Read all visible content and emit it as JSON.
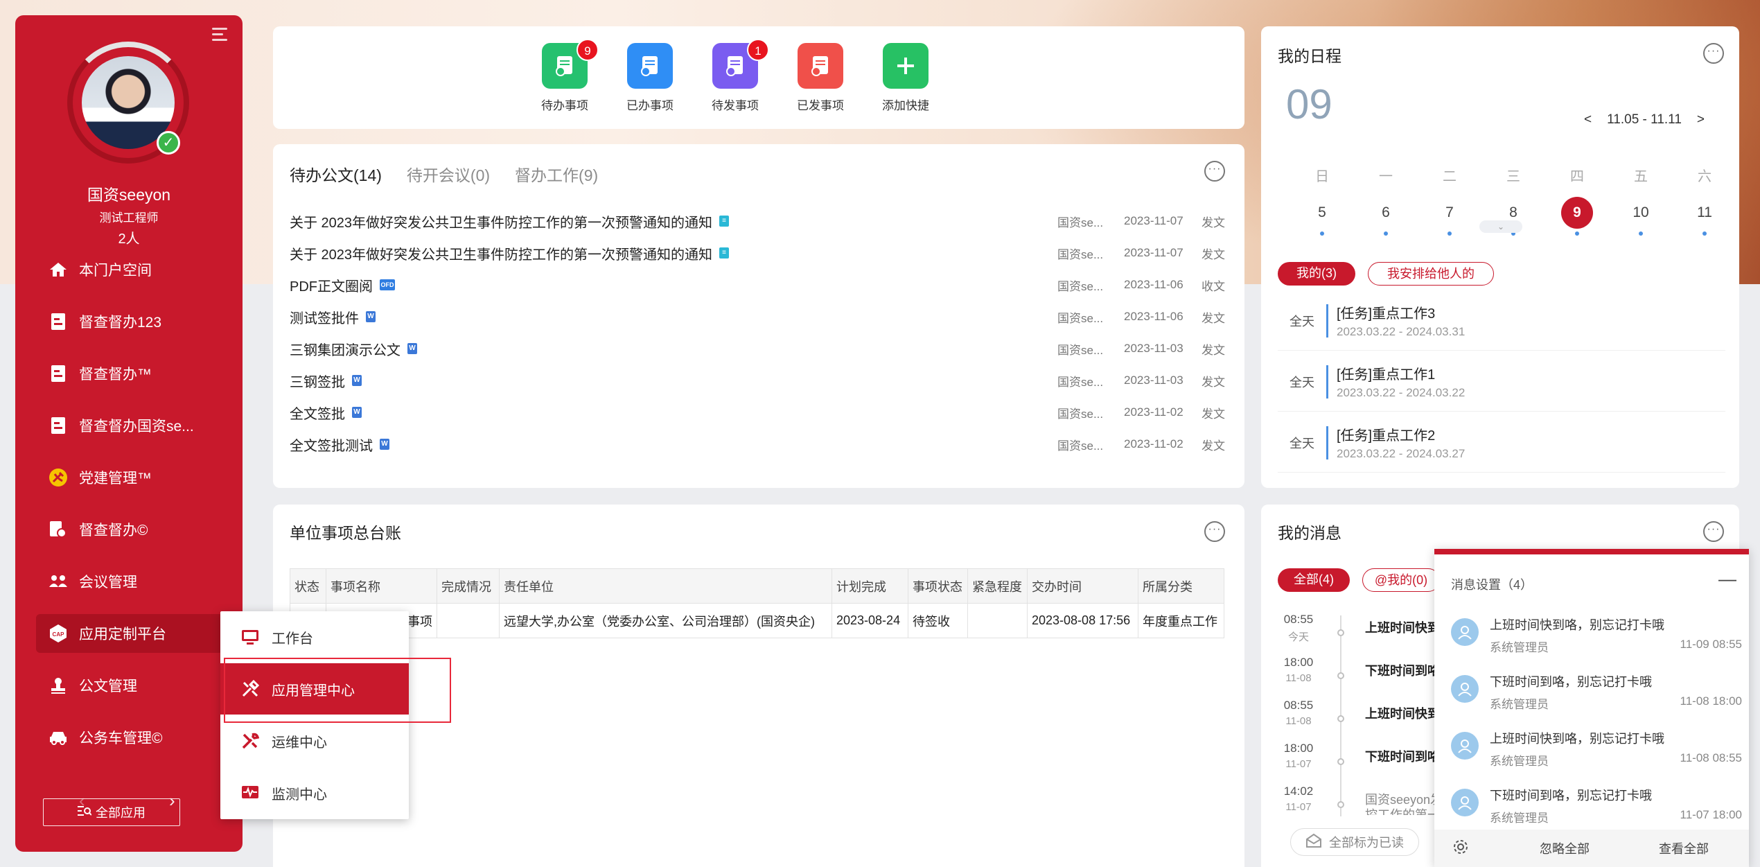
{
  "sidebar": {
    "user_name": "国资seeyon",
    "user_title": "测试工程师",
    "user_count": "2人",
    "items": [
      {
        "label": "本门户空间"
      },
      {
        "label": "督查督办123"
      },
      {
        "label": "督查督办™"
      },
      {
        "label": "督查督办国资se..."
      },
      {
        "label": "党建管理™"
      },
      {
        "label": "督查督办©"
      },
      {
        "label": "会议管理"
      },
      {
        "label": "应用定制平台"
      },
      {
        "label": "公文管理"
      },
      {
        "label": "公务车管理©"
      }
    ],
    "prev": "‹",
    "next": "›",
    "all_apps": "全部应用"
  },
  "shortcuts": [
    {
      "label": "待办事项",
      "badge": "9",
      "color": "#25c16f"
    },
    {
      "label": "已办事项",
      "badge": "",
      "color": "#2f8ef5"
    },
    {
      "label": "待发事项",
      "badge": "1",
      "color": "#7a5cf0"
    },
    {
      "label": "已发事项",
      "badge": "",
      "color": "#f0504a"
    },
    {
      "label": "添加快捷",
      "badge": "",
      "color": "#27c164"
    }
  ],
  "docs": {
    "tabs": [
      "待办公文(14)",
      "待开会议(0)",
      "督办工作(9)"
    ],
    "rows": [
      {
        "title": "关于 2023年做好突发公共卫生事件防控工作的第一次预警通知的通知",
        "sender": "国资se...",
        "date": "2023-11-07",
        "kind": "发文",
        "icon": "doc"
      },
      {
        "title": "关于 2023年做好突发公共卫生事件防控工作的第一次预警通知的通知",
        "sender": "国资se...",
        "date": "2023-11-07",
        "kind": "发文",
        "icon": "doc"
      },
      {
        "title": "PDF正文圈阅",
        "sender": "国资se...",
        "date": "2023-11-06",
        "kind": "收文",
        "icon": "ofd"
      },
      {
        "title": "测试签批件",
        "sender": "国资se...",
        "date": "2023-11-06",
        "kind": "发文",
        "icon": "word"
      },
      {
        "title": "三钢集团演示公文",
        "sender": "国资se...",
        "date": "2023-11-03",
        "kind": "发文",
        "icon": "word"
      },
      {
        "title": "三钢签批",
        "sender": "国资se...",
        "date": "2023-11-03",
        "kind": "发文",
        "icon": "word"
      },
      {
        "title": "全文签批",
        "sender": "国资se...",
        "date": "2023-11-02",
        "kind": "发文",
        "icon": "word"
      },
      {
        "title": "全文签批测试",
        "sender": "国资se...",
        "date": "2023-11-02",
        "kind": "发文",
        "icon": "word"
      }
    ]
  },
  "ledger": {
    "title": "单位事项总台账",
    "headers": [
      "状态",
      "事项名称",
      "完成情况",
      "责任单位",
      "计划完成",
      "事项状态",
      "紧急程度",
      "交办时间",
      "所属分类"
    ],
    "row": [
      "",
      "事项",
      "",
      "远望大学,办公室（党委办公室、公司治理部）(国资央企)",
      "2023-08-24",
      "待签收",
      "",
      "2023-08-08 17:56",
      "年度重点工作"
    ]
  },
  "dropdown": {
    "items": [
      {
        "label": "工作台"
      },
      {
        "label": "应用管理中心"
      },
      {
        "label": "运维中心"
      },
      {
        "label": "监测中心"
      }
    ]
  },
  "schedule": {
    "title": "我的日程",
    "day": "09",
    "range": "11.05 - 11.11",
    "prev": "<",
    "next": ">",
    "weekdays": [
      "日",
      "一",
      "二",
      "三",
      "四",
      "五",
      "六"
    ],
    "dates": [
      "5",
      "6",
      "7",
      "8",
      "9",
      "10",
      "11"
    ],
    "today_index": 4,
    "tabs": [
      "我的(3)",
      "我安排给他人的"
    ],
    "events": [
      {
        "allday": "全天",
        "title": "[任务]重点工作3",
        "range": "2023.03.22 - 2024.03.31"
      },
      {
        "allday": "全天",
        "title": "[任务]重点工作1",
        "range": "2023.03.22 - 2024.03.22"
      },
      {
        "allday": "全天",
        "title": "[任务]重点工作2",
        "range": "2023.03.22 - 2024.03.27"
      }
    ]
  },
  "messages": {
    "title": "我的消息",
    "tabs": [
      "全部(4)",
      "@我的(0)"
    ],
    "items": [
      {
        "time": "08:55",
        "date": "今天",
        "text": "上班时间快到"
      },
      {
        "time": "18:00",
        "date": "11-08",
        "text": "下班时间到咯"
      },
      {
        "time": "08:55",
        "date": "11-08",
        "text": "上班时间快到"
      },
      {
        "time": "18:00",
        "date": "11-07",
        "text": "下班时间到咯"
      },
      {
        "time": "14:02",
        "date": "11-07",
        "text": "国资seeyon发"
      },
      {
        "time": "",
        "date": "",
        "text": "控工作的第一"
      }
    ],
    "mark_all": "全部标为已读"
  },
  "notify": {
    "title": "消息设置（4）",
    "minimize": "—",
    "items": [
      {
        "text": "上班时间快到咯，别忘记打卡哦",
        "from": "系统管理员",
        "time": "11-09 08:55"
      },
      {
        "text": "下班时间到咯，别忘记打卡哦",
        "from": "系统管理员",
        "time": "11-08 18:00"
      },
      {
        "text": "上班时间快到咯，别忘记打卡哦",
        "from": "系统管理员",
        "time": "11-08 08:55"
      },
      {
        "text": "下班时间到咯，别忘记打卡哦",
        "from": "系统管理员",
        "time": "11-07 18:00"
      }
    ],
    "ignore_all": "忽略全部",
    "view_all": "查看全部"
  }
}
